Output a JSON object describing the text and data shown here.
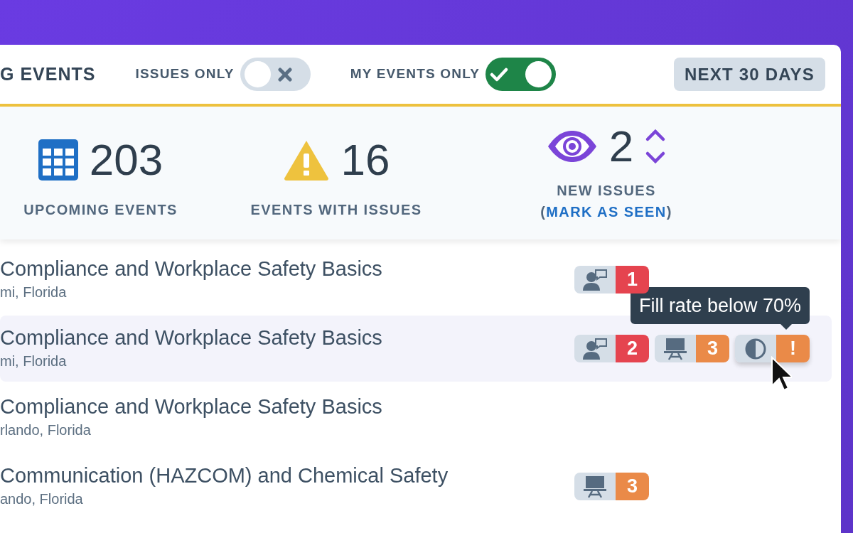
{
  "header": {
    "title": "G EVENTS",
    "toggles": [
      {
        "label": "ISSUES ONLY",
        "on": false
      },
      {
        "label": "MY EVENTS ONLY",
        "on": true
      }
    ],
    "range_button": "NEXT 30 DAYS"
  },
  "stats": [
    {
      "kind": "calendar",
      "value": "203",
      "label": "UPCOMING EVENTS"
    },
    {
      "kind": "warning",
      "value": "16",
      "label": "EVENTS WITH ISSUES"
    },
    {
      "kind": "eye",
      "value": "2",
      "label": "NEW ISSUES",
      "link_prefix": "(",
      "link": "MARK AS SEEN",
      "link_suffix": ")"
    }
  ],
  "events": [
    {
      "title": "Compliance and Workplace Safety Basics",
      "location": "mi, Florida",
      "selected": false,
      "badges": [
        {
          "kind": "instructor",
          "count": "1",
          "color": "#e5444f"
        }
      ]
    },
    {
      "title": "Compliance and Workplace Safety Basics",
      "location": "mi, Florida",
      "selected": true,
      "badges": [
        {
          "kind": "instructor",
          "count": "2",
          "color": "#e5444f"
        },
        {
          "kind": "classroom",
          "count": "3",
          "color": "#ea8a48"
        },
        {
          "kind": "fill",
          "count": "!",
          "color": "#ea8a48",
          "tooltip": "Fill rate below 70%"
        }
      ]
    },
    {
      "title": "Compliance and Workplace Safety Basics",
      "location": "rlando, Florida",
      "selected": false
    },
    {
      "title": "Communication (HAZCOM) and Chemical Safety",
      "location": "ando, Florida",
      "selected": false,
      "badges": [
        {
          "kind": "classroom",
          "count": "3",
          "color": "#ea8a48"
        }
      ]
    }
  ]
}
